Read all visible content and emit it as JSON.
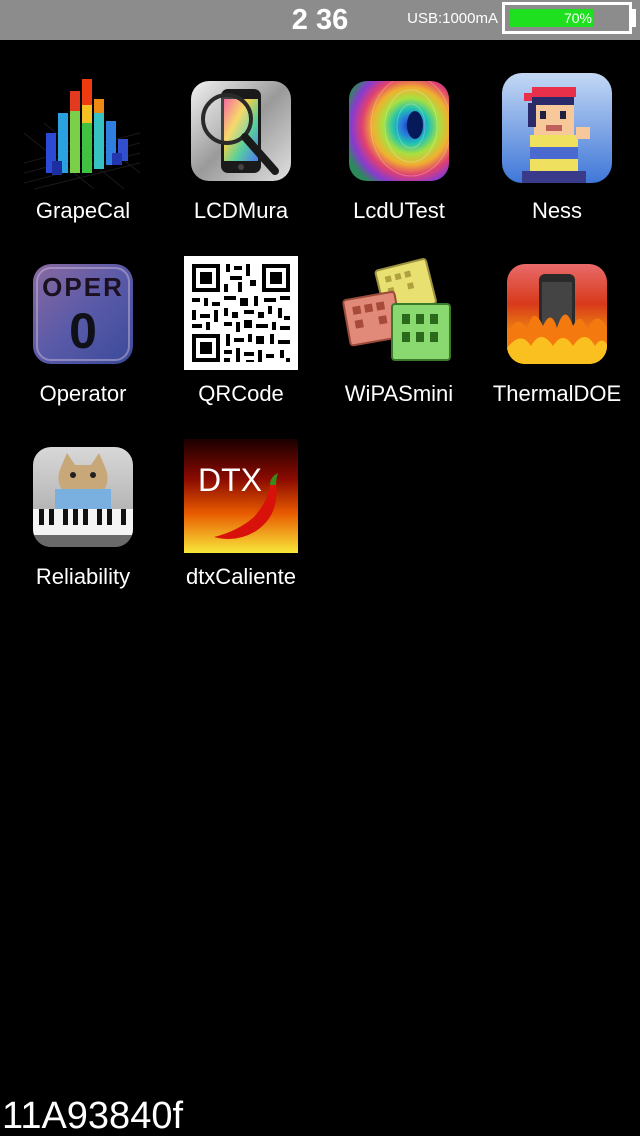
{
  "status_bar": {
    "time": "2 36",
    "usb": "USB:1000mA",
    "battery_text": "70%",
    "battery_level": 0.7,
    "battery_color": "#1fe01f",
    "bar_color": "#8c8c8c"
  },
  "apps": [
    {
      "label": "GrapeCal",
      "icon": "3d-bar-graph-icon"
    },
    {
      "label": "LCDMura",
      "icon": "phone-magnifier-icon"
    },
    {
      "label": "LcdUTest",
      "icon": "peacock-feather-icon"
    },
    {
      "label": "Ness",
      "icon": "pixel-character-icon"
    },
    {
      "label": "Operator",
      "icon": "oper-zero-icon",
      "text": "OPER",
      "digit": "0"
    },
    {
      "label": "QRCode",
      "icon": "qr-code-icon"
    },
    {
      "label": "WiPASmini",
      "icon": "chip-tiles-icon"
    },
    {
      "label": "ThermalDOE",
      "icon": "phone-flames-icon"
    },
    {
      "label": "Reliability",
      "icon": "keyboard-cat-icon"
    },
    {
      "label": "dtxCaliente",
      "icon": "chili-pepper-icon",
      "text": "DTX"
    }
  ],
  "build_id": "11A93840f"
}
